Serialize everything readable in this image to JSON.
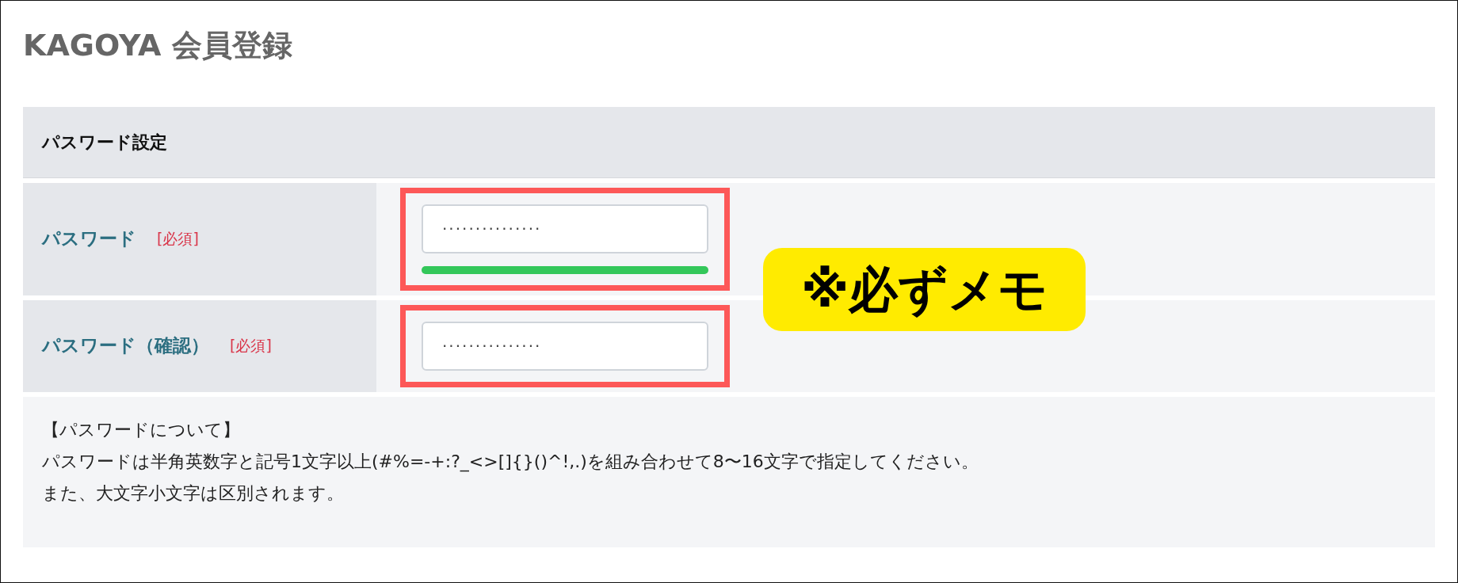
{
  "title": "KAGOYA 会員登録",
  "section": {
    "heading": "パスワード設定",
    "fields": [
      {
        "label": "パスワード",
        "required": "[必須]",
        "value": "···············",
        "highlighted": true,
        "strength": {
          "level": 1
        }
      },
      {
        "label": "パスワード（確認）",
        "required": "[必須]",
        "value": "···············",
        "highlighted": true
      }
    ],
    "callout": "※必ずメモ",
    "note": [
      "【パスワードについて】",
      "パスワードは半角英数字と記号1文字以上(#%=-+:?_<>[]{}()^!,.)を組み合わせて8〜16文字で指定してください。",
      "また、大文字小文字は区別されます。"
    ]
  }
}
